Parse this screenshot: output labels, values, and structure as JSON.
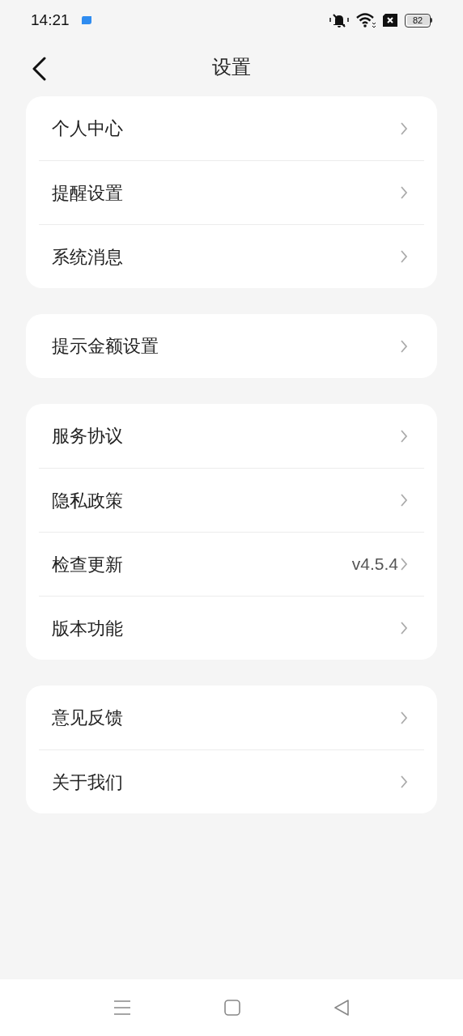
{
  "status_bar": {
    "time": "14:21",
    "battery": "82"
  },
  "header": {
    "title": "设置"
  },
  "groups": [
    {
      "items": [
        {
          "label": "个人中心"
        },
        {
          "label": "提醒设置"
        },
        {
          "label": "系统消息"
        }
      ]
    },
    {
      "items": [
        {
          "label": "提示金额设置"
        }
      ]
    },
    {
      "items": [
        {
          "label": "服务协议"
        },
        {
          "label": "隐私政策"
        },
        {
          "label": "检查更新",
          "value": "v4.5.4"
        },
        {
          "label": "版本功能"
        }
      ]
    },
    {
      "items": [
        {
          "label": "意见反馈"
        },
        {
          "label": "关于我们"
        }
      ]
    }
  ]
}
